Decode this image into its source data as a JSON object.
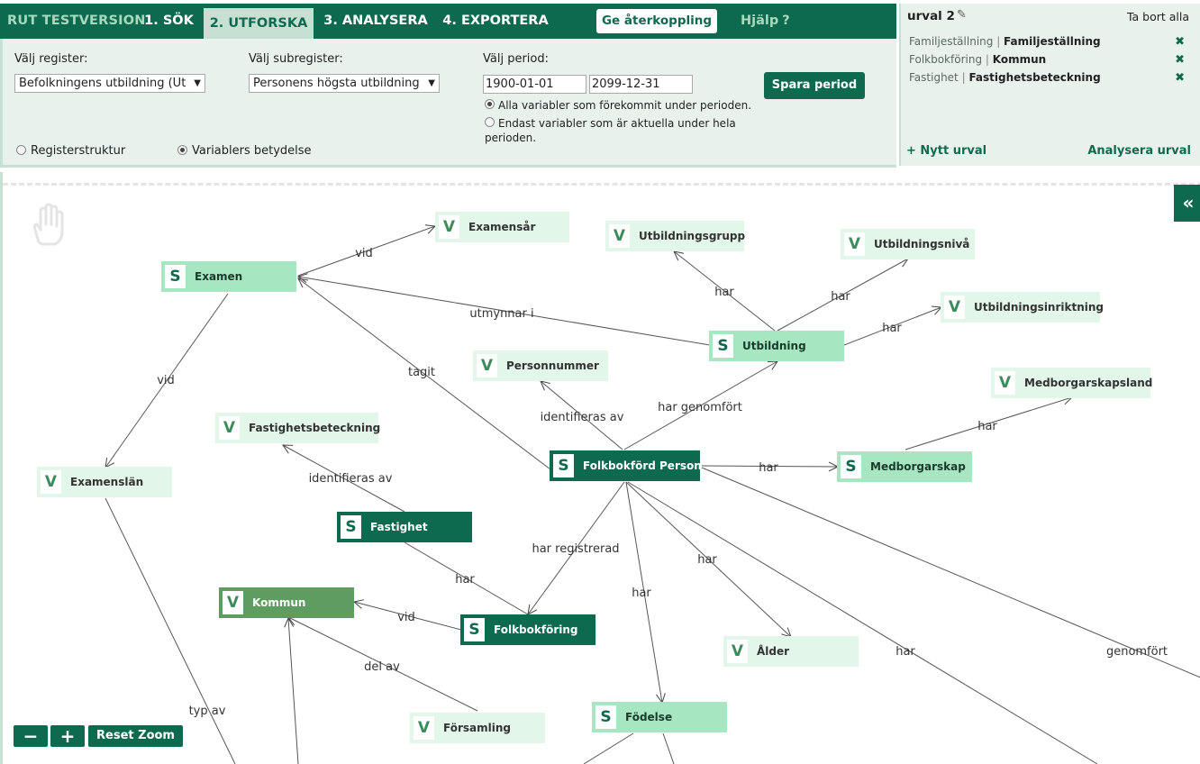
{
  "nav": {
    "brand": "RUT TESTVERSION",
    "tabs": [
      {
        "label": "1. SÖK"
      },
      {
        "label": "2. UTFORSKA"
      },
      {
        "label": "3. ANALYSERA"
      },
      {
        "label": "4. EXPORTERA"
      }
    ],
    "feedback": "Ge återkoppling",
    "help": "Hjälp",
    "help_icon": "?"
  },
  "settings": {
    "register_label": "Välj register:",
    "register_value": "Befolkningens utbildning (Ut",
    "subregister_label": "Välj subregister:",
    "subregister_value": "Personens högsta utbildning",
    "period_label": "Välj period:",
    "date_from": "1900-01-01",
    "date_to": "2099-12-31",
    "save_period": "Spara period",
    "radio_all": "Alla variabler som förekommit under perioden.",
    "radio_current_line1": "Endast variabler som är aktuella under hela",
    "radio_current_line2": "perioden.",
    "view_structure": "Registerstruktur",
    "view_meaning": "Variablers betydelse"
  },
  "urval": {
    "title": "urval 2",
    "remove_all": "Ta bort alla",
    "items": [
      {
        "category": "Familjeställning",
        "value": "Familjeställning"
      },
      {
        "category": "Folkbokföring",
        "value": "Kommun"
      },
      {
        "category": "Fastighet",
        "value": "Fastighetsbeteckning"
      }
    ],
    "new": "Nytt urval",
    "analyze": "Analysera urval"
  },
  "graph": {
    "nodes": {
      "examen": {
        "badge": "S",
        "label": "Examen"
      },
      "examensar": {
        "badge": "V",
        "label": "Examensår"
      },
      "utbildningsgrupp": {
        "badge": "V",
        "label": "Utbildningsgrupp"
      },
      "utbildningsniva": {
        "badge": "V",
        "label": "Utbildningsnivå"
      },
      "utbildningsinriktning": {
        "badge": "V",
        "label": "Utbildningsinriktning"
      },
      "utbildning": {
        "badge": "S",
        "label": "Utbildning"
      },
      "personnummer": {
        "badge": "V",
        "label": "Personnummer"
      },
      "medborgarskapsland": {
        "badge": "V",
        "label": "Medborgarskapsland"
      },
      "fastighetsbeteckning": {
        "badge": "V",
        "label": "Fastighetsbeteckning"
      },
      "examenslan": {
        "badge": "V",
        "label": "Examenslän"
      },
      "folkbokford_person": {
        "badge": "S",
        "label": "Folkbokförd Person"
      },
      "medborgarskap": {
        "badge": "S",
        "label": "Medborgarskap"
      },
      "fastighet": {
        "badge": "S",
        "label": "Fastighet"
      },
      "kommun": {
        "badge": "V",
        "label": "Kommun"
      },
      "folkbokforing": {
        "badge": "S",
        "label": "Folkbokföring"
      },
      "alder": {
        "badge": "V",
        "label": "Ålder"
      },
      "forsamling": {
        "badge": "V",
        "label": "Församling"
      },
      "fodelse": {
        "badge": "S",
        "label": "Födelse"
      }
    },
    "edge_labels": {
      "vid1": "vid",
      "utmynnar": "utmynnar i",
      "tagit": "tagit",
      "vid2": "vid",
      "har_grupp": "har",
      "har_niva": "har",
      "har_inriktning": "har",
      "identifieras1": "identifieras av",
      "har_genomfort": "har genomfört",
      "har_land": "har",
      "har_medb": "har",
      "identifieras2": "identifieras av",
      "har_registrerad": "har registrerad",
      "har_fastighet": "har",
      "har_alder": "har",
      "har_fodelse": "har",
      "har_far": "har",
      "genomfort": "genomfört",
      "vid3": "vid",
      "del_av": "del av",
      "typ_av": "typ av"
    }
  },
  "zoom": {
    "minus": "−",
    "plus": "+",
    "reset": "Reset Zoom"
  },
  "collapse_icon": "«",
  "colors": {
    "primary": "#0e6a4e",
    "panel_bg": "#e8f1ec",
    "active_tab": "#c6e1d3",
    "node_light": "#a6e6c0",
    "node_pale": "#e3f6ea"
  }
}
